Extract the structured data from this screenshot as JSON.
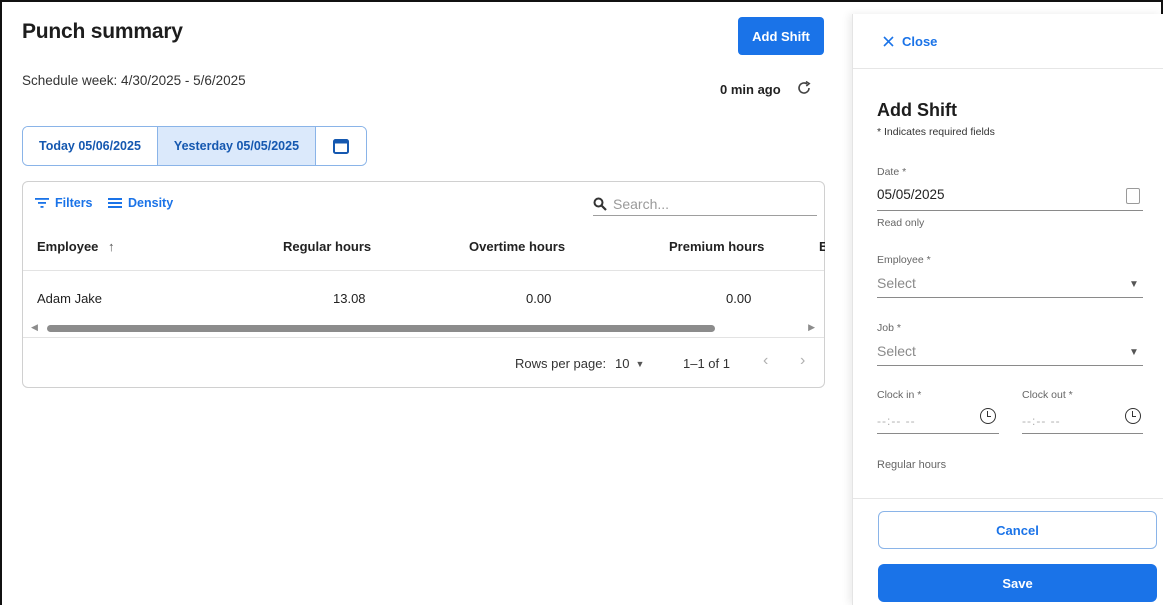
{
  "main": {
    "title": "Punch summary",
    "add_shift_label": "Add Shift",
    "schedule_week": "Schedule week: 4/30/2025 - 5/6/2025",
    "refresh_time": "0 min ago",
    "date_tabs": [
      {
        "label": "Today 05/06/2025",
        "active": false
      },
      {
        "label": "Yesterday 05/05/2025",
        "active": true
      }
    ],
    "toolbar": {
      "filters_label": "Filters",
      "density_label": "Density",
      "search_placeholder": "Search..."
    },
    "table": {
      "columns": [
        "Employee",
        "Regular hours",
        "Overtime hours",
        "Premium hours",
        "E"
      ],
      "rows": [
        [
          "Adam Jake",
          "13.08",
          "0.00",
          "0.00"
        ]
      ]
    },
    "pagination": {
      "rows_per_page_label": "Rows per page:",
      "rows_per_page_value": "10",
      "range": "1–1 of 1"
    }
  },
  "panel": {
    "close_label": "Close",
    "title": "Add Shift",
    "required_note": "* Indicates required fields",
    "date": {
      "label": "Date *",
      "value": "05/05/2025",
      "helper": "Read only"
    },
    "employee": {
      "label": "Employee *",
      "placeholder": "Select"
    },
    "job": {
      "label": "Job *",
      "placeholder": "Select"
    },
    "clock_in": {
      "label": "Clock in *",
      "placeholder": "--:-- --"
    },
    "clock_out": {
      "label": "Clock out *",
      "placeholder": "--:-- --"
    },
    "regular_hours_label": "Regular hours",
    "cancel_label": "Cancel",
    "save_label": "Save"
  },
  "colors": {
    "accent": "#1a73e8",
    "active_tab_bg": "#dbe9fb"
  }
}
